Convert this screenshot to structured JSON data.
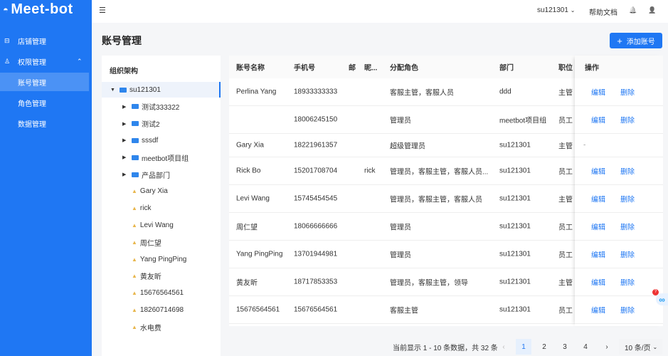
{
  "app": {
    "logo": "Meet-bot"
  },
  "sidebar": {
    "items": [
      {
        "label": "店铺管理",
        "icon": "store-icon"
      },
      {
        "label": "权限管理",
        "icon": "user-icon",
        "chevron": "^"
      },
      {
        "label": "账号管理"
      },
      {
        "label": "角色管理"
      },
      {
        "label": "数据管理"
      }
    ]
  },
  "header": {
    "menu_icon": "☰",
    "account": "su121301",
    "help": "帮助文档",
    "bell": "🔔",
    "user": "👤"
  },
  "page": {
    "title": "账号管理",
    "add_button": "添加账号"
  },
  "tree": {
    "title": "组织架构",
    "nodes": [
      {
        "label": "su121301",
        "type": "folder",
        "level": 0,
        "expanded": true
      },
      {
        "label": "测试333322",
        "type": "folder",
        "level": 1
      },
      {
        "label": "测试2",
        "type": "folder",
        "level": 1
      },
      {
        "label": "sssdf",
        "type": "folder",
        "level": 1
      },
      {
        "label": "meetbot项目组",
        "type": "folder",
        "level": 1
      },
      {
        "label": "产品部门",
        "type": "folder",
        "level": 1
      },
      {
        "label": "Gary Xia",
        "type": "user",
        "level": 1
      },
      {
        "label": "rick",
        "type": "user",
        "level": 1
      },
      {
        "label": "Levi Wang",
        "type": "user",
        "level": 1
      },
      {
        "label": "周仁望",
        "type": "user",
        "level": 1
      },
      {
        "label": "Yang PingPing",
        "type": "user",
        "level": 1
      },
      {
        "label": "黄友昕",
        "type": "user",
        "level": 1
      },
      {
        "label": "15676564561",
        "type": "user",
        "level": 1
      },
      {
        "label": "18260714698",
        "type": "user",
        "level": 1
      },
      {
        "label": "水电费",
        "type": "user",
        "level": 1
      }
    ]
  },
  "table": {
    "columns": [
      "账号名称",
      "手机号",
      "邮",
      "昵...",
      "分配角色",
      "部门",
      "职位",
      "操作"
    ],
    "edit": "编辑",
    "delete": "删除",
    "rows": [
      [
        "Perlina Yang",
        "18933333333",
        "",
        "",
        "客服主管，客服人员",
        "ddd",
        "主管",
        true
      ],
      [
        "",
        "18006245150",
        "",
        "",
        "管理员",
        "meetbot项目组",
        "员工",
        true
      ],
      [
        "Gary Xia",
        "18221961357",
        "",
        "",
        "超级管理员",
        "su121301",
        "主管",
        false
      ],
      [
        "Rick Bo",
        "15201708704",
        "",
        "rick",
        "管理员，客服主管，客服人员...",
        "su121301",
        "员工",
        true
      ],
      [
        "Levi Wang",
        "15745454545",
        "",
        "",
        "管理员，客服主管，客服人员",
        "su121301",
        "主管",
        true
      ],
      [
        "周仁望",
        "18066666666",
        "",
        "",
        "管理员",
        "su121301",
        "员工",
        true
      ],
      [
        "Yang PingPing",
        "13701944981",
        "",
        "",
        "管理员",
        "su121301",
        "员工",
        true
      ],
      [
        "黄友昕",
        "18717853353",
        "",
        "",
        "管理员，客服主管，领导",
        "su121301",
        "主管",
        true
      ],
      [
        "15676564561",
        "15676564561",
        "",
        "",
        "客服主管",
        "su121301",
        "员工",
        true
      ]
    ],
    "no_action": "-"
  },
  "pagination": {
    "summary": "当前显示 1 - 10 条数据，共 32 条",
    "prev": "‹",
    "pages": [
      "1",
      "2",
      "3",
      "4"
    ],
    "current": "1",
    "next": "›",
    "page_size": "10 条/页"
  },
  "colors": {
    "brand": "#1f77f3"
  }
}
